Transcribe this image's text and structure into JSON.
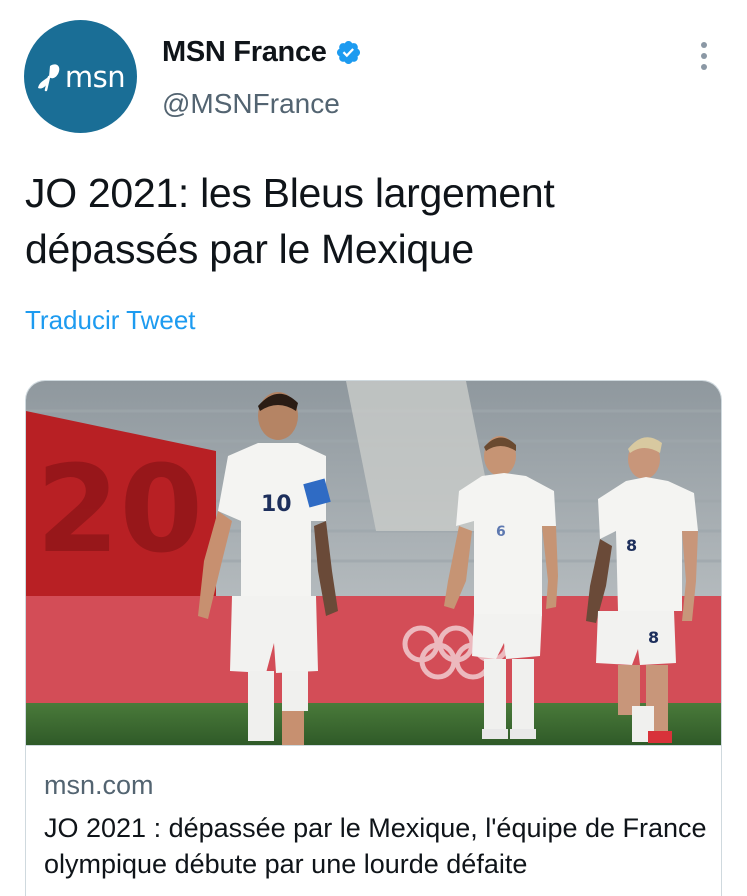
{
  "author": {
    "display_name": "MSN France",
    "handle": "@MSNFrance",
    "avatar_logo_text": "msn",
    "verified_icon": "verified-badge-icon",
    "verified_color": "#1d9bf0"
  },
  "tweet": {
    "line1": "JO 2021: les Bleus largement",
    "line2": "dépassés par le Mexique",
    "translate_label": "Traducir Tweet"
  },
  "card": {
    "domain": "msn.com",
    "title": "JO 2021 : dépassée par le Mexique, l'équipe de France olympique débute par une lourde défaite",
    "image_jersey_numbers": [
      "10",
      "6",
      "8"
    ]
  },
  "colors": {
    "avatar_bg": "#1a6e96",
    "link_blue": "#1d9bf0",
    "secondary_text": "#536471"
  }
}
